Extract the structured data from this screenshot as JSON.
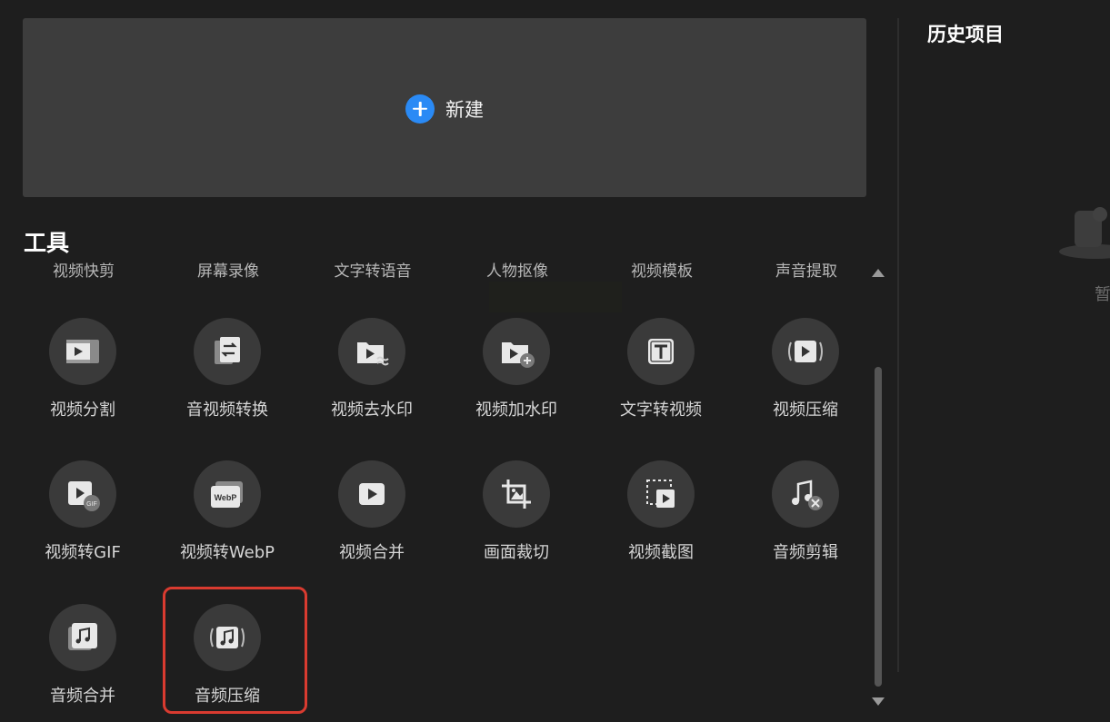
{
  "new_project": {
    "label": "新建"
  },
  "tools": {
    "title": "工具",
    "partial_row": [
      "视频快剪",
      "屏幕录像",
      "文字转语音",
      "人物抠像",
      "视频模板",
      "声音提取"
    ],
    "items": [
      {
        "label": "视频分割",
        "icon": "video-split-icon"
      },
      {
        "label": "音视频转换",
        "icon": "format-convert-icon"
      },
      {
        "label": "视频去水印",
        "icon": "remove-watermark-icon"
      },
      {
        "label": "视频加水印",
        "icon": "add-watermark-icon"
      },
      {
        "label": "文字转视频",
        "icon": "text-to-video-icon"
      },
      {
        "label": "视频压缩",
        "icon": "video-compress-icon"
      },
      {
        "label": "视频转GIF",
        "icon": "gif-icon"
      },
      {
        "label": "视频转WebP",
        "icon": "webp-icon"
      },
      {
        "label": "视频合并",
        "icon": "video-merge-icon"
      },
      {
        "label": "画面裁切",
        "icon": "crop-icon"
      },
      {
        "label": "视频截图",
        "icon": "screenshot-icon"
      },
      {
        "label": "音频剪辑",
        "icon": "audio-cut-icon"
      },
      {
        "label": "音频合并",
        "icon": "audio-merge-icon"
      },
      {
        "label": "音频压缩",
        "icon": "audio-compress-icon"
      }
    ],
    "highlighted": "音频压缩",
    "webp_badge": "WebP",
    "gif_badge": "GIF"
  },
  "history": {
    "title": "历史项目",
    "empty_text_partial": "暂"
  },
  "colors": {
    "accent": "#2a8af5",
    "highlight": "#d93b30",
    "background": "#1e1e1e",
    "card": "#3d3d3d"
  }
}
